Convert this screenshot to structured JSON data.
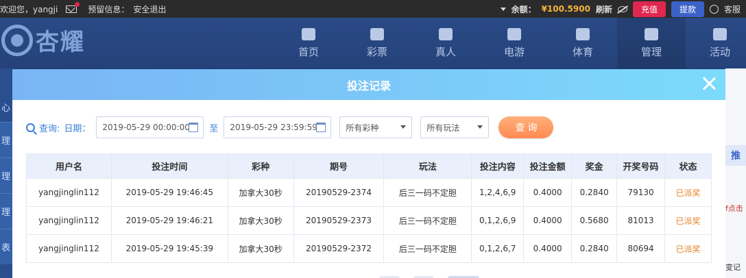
{
  "topbar": {
    "welcome": "欢迎您，yangji",
    "notice_label": "预留信息：",
    "logout": "安全退出",
    "balance_label": "余额：",
    "balance_value": "¥100.5900",
    "refresh": "刷新",
    "recharge": "充值",
    "withdraw": "提款",
    "service": "客服"
  },
  "logo": {
    "text": "杏耀"
  },
  "nav": [
    {
      "label": "首页"
    },
    {
      "label": "彩票"
    },
    {
      "label": "真人"
    },
    {
      "label": "电游"
    },
    {
      "label": "体育"
    },
    {
      "label": "管理"
    },
    {
      "label": "活动"
    }
  ],
  "left_side": [
    "心",
    "理",
    "理",
    "理",
    "表"
  ],
  "right_side": {
    "tab": "推",
    "text1": "f点击",
    "text2": "变记"
  },
  "modal": {
    "title": "投注记录",
    "filter": {
      "query_label": "查询:",
      "date_label": "日期：",
      "start_date": "2019-05-29 00:00:00",
      "to_label": "至",
      "end_date": "2019-05-29 23:59:59",
      "lottery_select": "所有彩种",
      "play_select": "所有玩法",
      "query_button": "查 询"
    },
    "table": {
      "headers": [
        "用户名",
        "投注时间",
        "彩种",
        "期号",
        "玩法",
        "投注内容",
        "投注金额",
        "奖金",
        "开奖号码",
        "状态"
      ],
      "rows": [
        [
          "yangjinglin112",
          "2019-05-29 19:46:45",
          "加拿大30秒",
          "20190529-2374",
          "后三一码不定胆",
          "1,2,4,6,9",
          "0.4000",
          "0.2840",
          "79130",
          "已派奖"
        ],
        [
          "yangjinglin112",
          "2019-05-29 19:46:21",
          "加拿大30秒",
          "20190529-2373",
          "后三一码不定胆",
          "0,1,2,6,9",
          "0.4000",
          "0.5680",
          "81013",
          "已派奖"
        ],
        [
          "yangjinglin112",
          "2019-05-29 19:45:39",
          "加拿大30秒",
          "20190529-2372",
          "后三一码不定胆",
          "0,1,2,6,7",
          "0.4000",
          "0.2840",
          "80694",
          "已派奖"
        ]
      ]
    }
  }
}
